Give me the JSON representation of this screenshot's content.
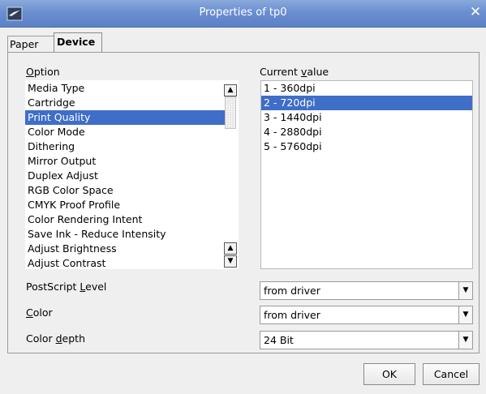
{
  "window": {
    "title": "Properties of tp0",
    "close_glyph": "✕"
  },
  "tabs": [
    {
      "label": "Paper"
    },
    {
      "label": "Device"
    }
  ],
  "options_panel": {
    "option_label_u": "O",
    "option_label_rest": "ption",
    "items": [
      "Media Type",
      "Cartridge",
      "Print Quality",
      "Color Mode",
      "Dithering",
      "Mirror Output",
      "Duplex Adjust",
      "RGB Color Space",
      "CMYK Proof Profile",
      "Color Rendering Intent",
      "Save Ink - Reduce Intensity",
      "Adjust Brightness",
      "Adjust Contrast"
    ],
    "selected": "Print Quality"
  },
  "values_panel": {
    "label_pre": "Current ",
    "label_u": "v",
    "label_post": "alue",
    "items": [
      "1 - 360dpi",
      "2 - 720dpi",
      "3 - 1440dpi",
      "4 - 2880dpi",
      "5 - 5760dpi"
    ],
    "selected": "2 - 720dpi"
  },
  "settings": {
    "postscript": {
      "label_pre": "PostScript ",
      "label_u": "L",
      "label_post": "evel",
      "value": "from driver"
    },
    "color": {
      "label_pre": "",
      "label_u": "C",
      "label_post": "olor",
      "value": "from driver"
    },
    "color_depth": {
      "label_pre": "Color ",
      "label_u": "d",
      "label_post": "epth",
      "value": "24 Bit"
    }
  },
  "buttons": {
    "ok": "OK",
    "cancel": "Cancel"
  },
  "colors": {
    "titlebar": "#6b8fd0",
    "selection": "#3e6ec8",
    "dialog_bg": "#efefef"
  }
}
